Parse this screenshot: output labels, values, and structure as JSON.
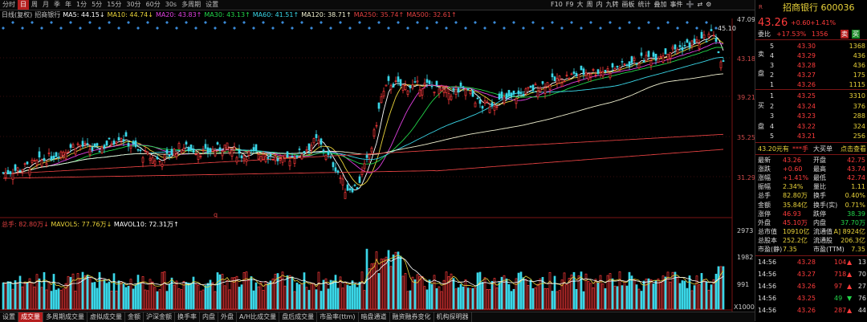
{
  "period_bar": {
    "items": [
      "分时",
      "日",
      "周",
      "月",
      "季",
      "年",
      "1分",
      "5分",
      "15分",
      "30分",
      "60分",
      "30s",
      "多周期",
      "设置"
    ],
    "active": 1
  },
  "toolbar": {
    "items": [
      "F10",
      "F9",
      "大",
      "周",
      "内",
      "九转",
      "画板",
      "统计",
      "叠加",
      "事件",
      "➕",
      "⇄",
      "⚙"
    ]
  },
  "ma_line": {
    "parts": [
      {
        "text": "日线(复权)",
        "color": "#cccccc"
      },
      {
        "text": "招商银行",
        "color": "#cccccc"
      },
      {
        "text": "MA5: 44.15↓",
        "color": "#ffffff"
      },
      {
        "text": "MA10: 44.74↓",
        "color": "#e8d23a"
      },
      {
        "text": "MA20: 43.83↑",
        "color": "#e040e0"
      },
      {
        "text": "MA30: 43.13↑",
        "color": "#22d64a"
      },
      {
        "text": "MA60: 41.51↑",
        "color": "#3ad7e8"
      },
      {
        "text": "MA120: 38.71↑",
        "color": "#f0f0d0"
      },
      {
        "text": "MA250: 35.74↑",
        "color": "#e04040"
      },
      {
        "text": "MA500: 32.61↑",
        "color": "#e04040"
      }
    ]
  },
  "y_axis": {
    "top_max": "47.09",
    "labels": [
      "43.18",
      "39.21",
      "35.25",
      "31.29"
    ]
  },
  "annot": {
    "high": "45.10",
    "low": "q"
  },
  "vol_line": {
    "parts": [
      {
        "text": "总手: 82.80万↓",
        "color": "#e04040"
      },
      {
        "text": "MAVOL5: 77.76万↓",
        "color": "#e8d23a"
      },
      {
        "text": "MAVOL10: 72.31万↑",
        "color": "#ffffff"
      }
    ]
  },
  "vol_axis": {
    "labels": [
      "2973",
      "1982",
      "991",
      "X1000"
    ]
  },
  "tabs": {
    "items": [
      "设置",
      "成交量",
      "多周期成交量",
      "虚拟成交量",
      "金额",
      "沪深金额",
      "换手率",
      "内盘",
      "外盘",
      "A/H比成交量",
      "盘后成交量",
      "市盈率(ttm)",
      "暗盘通道",
      "融资融券变化",
      "机构探明器"
    ],
    "active": 1
  },
  "panel": {
    "stock_name": "招商银行 600036",
    "price": "43.26",
    "change": "+0.60",
    "change_pct": "+1.41%",
    "committee": {
      "label": "委比",
      "value": "+17.53%",
      "diff": "1356",
      "sell_tag": "卖",
      "buy_tag": "买"
    },
    "asks": [
      {
        "n": "5",
        "p": "43.30",
        "v": "1368"
      },
      {
        "n": "4",
        "p": "43.29",
        "v": "436"
      },
      {
        "n": "3",
        "p": "43.28",
        "v": "436"
      },
      {
        "n": "2",
        "p": "43.27",
        "v": "175"
      },
      {
        "n": "1",
        "p": "43.26",
        "v": "1115"
      }
    ],
    "ask_side_labels": [
      "卖",
      "盘"
    ],
    "bids": [
      {
        "n": "1",
        "p": "43.25",
        "v": "3310"
      },
      {
        "n": "2",
        "p": "43.24",
        "v": "376"
      },
      {
        "n": "3",
        "p": "43.23",
        "v": "288"
      },
      {
        "n": "4",
        "p": "43.22",
        "v": "324"
      },
      {
        "n": "5",
        "p": "43.21",
        "v": "256"
      }
    ],
    "bid_side_labels": [
      "买",
      "盘"
    ],
    "bigorder": {
      "a": "43.20元有",
      "b": "***手",
      "c": "大买单",
      "d": "点击查看"
    },
    "stats": [
      {
        "l1": "最新",
        "v1": "43.26",
        "l2": "开盘",
        "v2": "42.75"
      },
      {
        "l1": "涨跌",
        "v1": "+0.60",
        "l2": "最高",
        "v2": "43.74"
      },
      {
        "l1": "涨幅",
        "v1": "+1.41%",
        "l2": "最低",
        "v2": "42.74"
      },
      {
        "l1": "振幅",
        "v1": "2.34%",
        "l2": "量比",
        "v2": "1.11"
      },
      {
        "l1": "总手",
        "v1": "82.80万",
        "l2": "换手",
        "v2": "0.40%"
      },
      {
        "l1": "金额",
        "v1": "35.84亿",
        "l2": "换手(实)",
        "v2": "0.71%"
      },
      {
        "l1": "涨停",
        "v1": "46.93",
        "l2": "跌停",
        "v2": "38.39"
      },
      {
        "l1": "外盘",
        "v1": "45.10万",
        "l2": "内盘",
        "v2": "37.70万"
      },
      {
        "l1": "总市值",
        "v1": "10910亿",
        "l2": "流通值",
        "v2": "A] 8924亿"
      },
      {
        "l1": "总股本",
        "v1": "252.2亿",
        "l2": "流通股",
        "v2": "206.3亿"
      },
      {
        "l1": "市盈(静)",
        "v1": "7.35",
        "l2": "市盈(TTM)",
        "v2": "7.35"
      }
    ],
    "ticks": [
      {
        "t": "14:56",
        "p": "43.28",
        "v": "104",
        "dir": "up"
      },
      {
        "t": "14:56",
        "p": "43.27",
        "v": "718",
        "dir": "up"
      },
      {
        "t": "14:56",
        "p": "43.26",
        "v": "97",
        "dir": "up"
      },
      {
        "t": "14:56",
        "p": "43.25",
        "v": "49",
        "dir": "down"
      },
      {
        "t": "14:56",
        "p": "43.26",
        "v": "287",
        "dir": "up"
      }
    ],
    "tick_tail": [
      "13",
      "70",
      "27",
      "76",
      "44"
    ]
  },
  "chart_data": {
    "type": "candlestick",
    "ylim": [
      29.5,
      47.5
    ],
    "close_start": 31.0,
    "close_end": 43.26,
    "high": 45.1,
    "ma_labels": [
      "MA5",
      "MA10",
      "MA20",
      "MA30",
      "MA60",
      "MA120",
      "MA250",
      "MA500"
    ],
    "vol_max": 2973
  }
}
